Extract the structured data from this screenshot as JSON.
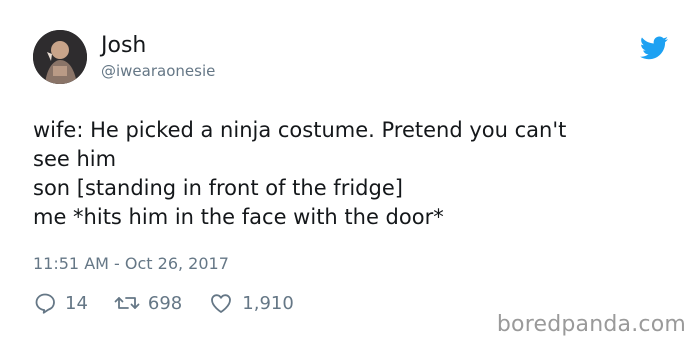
{
  "tweet": {
    "author": {
      "name": "Josh",
      "handle": "@iwearaonesie"
    },
    "text_lines": [
      "wife: He picked a ninja costume. Pretend you can't",
      "see him",
      "son [standing in front of the fridge]",
      "me *hits him in the face with the door*"
    ],
    "timestamp": "11:51 AM - Oct 26, 2017",
    "actions": {
      "replies": "14",
      "retweets": "698",
      "likes": "1,910"
    },
    "icons": {
      "logo": "twitter-bird-icon",
      "reply": "reply-icon",
      "retweet": "retweet-icon",
      "like": "heart-icon"
    },
    "colors": {
      "brand": "#1da1f2",
      "secondary_text": "#657786",
      "primary_text": "#14171a"
    }
  },
  "watermark": "boredpanda.com"
}
